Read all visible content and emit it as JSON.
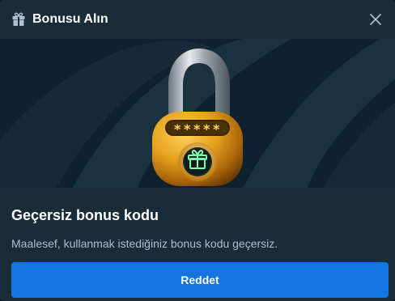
{
  "header": {
    "icon": "gift-icon",
    "title": "Bonusu Alın",
    "close_icon": "close-icon"
  },
  "hero": {
    "illustration": "padlock-gift-icon",
    "code_mask": "*****"
  },
  "message": {
    "title": "Geçersiz bonus kodu",
    "body": "Maalesef, kullanmak istediğiniz bonus kodu geçersiz."
  },
  "actions": {
    "dismiss_label": "Reddet"
  },
  "colors": {
    "modal_bg": "#1a2c38",
    "hero_bg": "#0f212e",
    "button_bg": "#1475e1",
    "body_text": "#b1bad3"
  }
}
